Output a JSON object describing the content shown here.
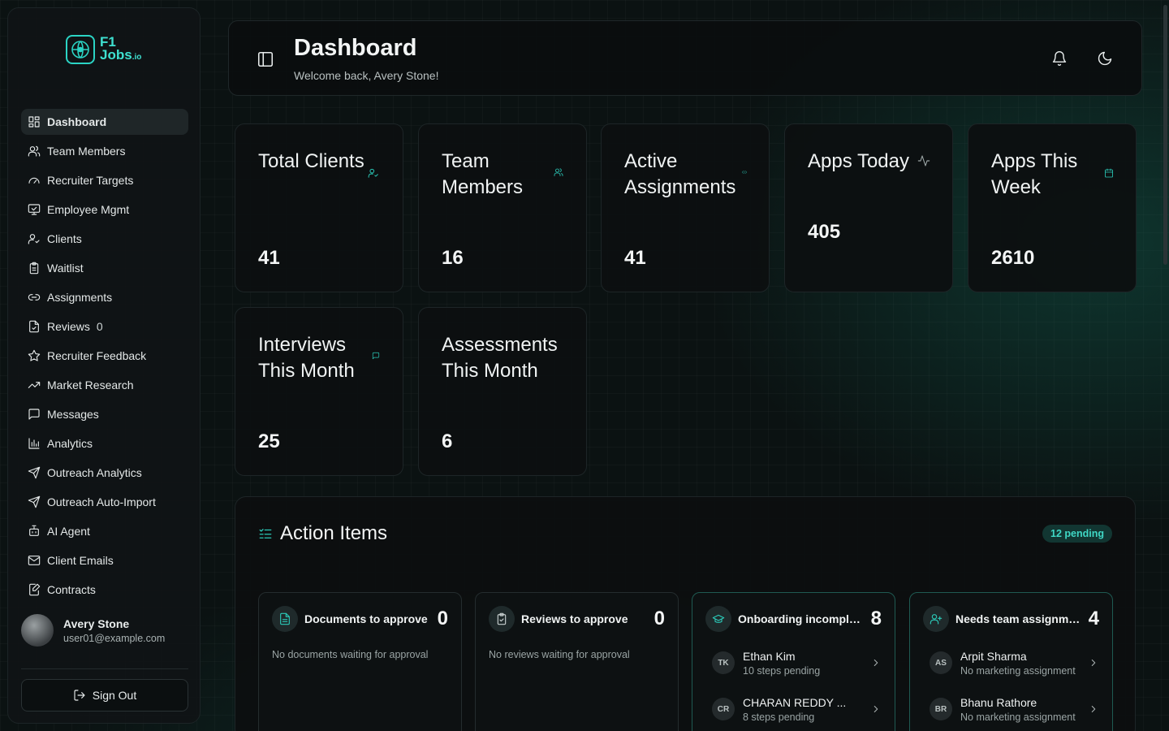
{
  "brand": {
    "name_line1": "F1",
    "name_line2": "Jobs",
    "name_suffix": ".io",
    "accent": "#2bd4c4"
  },
  "sidebar": {
    "items": [
      {
        "label": "Dashboard",
        "icon": "dashboard-icon",
        "active": true
      },
      {
        "label": "Team Members",
        "icon": "users-icon"
      },
      {
        "label": "Recruiter Targets",
        "icon": "gauge-icon"
      },
      {
        "label": "Employee Mgmt",
        "icon": "monitor-icon"
      },
      {
        "label": "Clients",
        "icon": "user-check-icon"
      },
      {
        "label": "Waitlist",
        "icon": "clipboard-icon"
      },
      {
        "label": "Assignments",
        "icon": "link-icon"
      },
      {
        "label": "Reviews",
        "icon": "file-check-icon",
        "count": "0"
      },
      {
        "label": "Recruiter Feedback",
        "icon": "star-icon"
      },
      {
        "label": "Market Research",
        "icon": "trending-up-icon"
      },
      {
        "label": "Messages",
        "icon": "message-icon"
      },
      {
        "label": "Analytics",
        "icon": "bar-chart-icon"
      },
      {
        "label": "Outreach Analytics",
        "icon": "send-icon"
      },
      {
        "label": "Outreach Auto-Import",
        "icon": "send-icon"
      },
      {
        "label": "AI Agent",
        "icon": "bot-icon"
      },
      {
        "label": "Client Emails",
        "icon": "mail-icon"
      },
      {
        "label": "Contracts",
        "icon": "file-edit-icon"
      }
    ],
    "user": {
      "name": "Avery Stone",
      "email": "user01@example.com"
    },
    "sign_out": "Sign Out"
  },
  "header": {
    "title": "Dashboard",
    "subtitle": "Welcome back, Avery Stone!"
  },
  "stats": [
    {
      "title": "Total Clients",
      "value": "41",
      "icon": "user-check-icon"
    },
    {
      "title": "Team Members",
      "value": "16",
      "icon": "users-icon"
    },
    {
      "title": "Active Assignments",
      "value": "41",
      "icon": "link-icon"
    },
    {
      "title": "Apps Today",
      "value": "405",
      "icon": "activity-icon"
    },
    {
      "title": "Apps This Week",
      "value": "2610",
      "icon": "calendar-icon"
    },
    {
      "title": "Interviews This Month",
      "value": "25",
      "icon": "message-icon"
    },
    {
      "title": "Assessments This Month",
      "value": "6",
      "icon": ""
    }
  ],
  "actions": {
    "title": "Action Items",
    "pending": "12 pending",
    "cards": [
      {
        "label": "Documents to approve",
        "count": "0",
        "icon": "file-text-icon",
        "empty": "No documents waiting for approval",
        "rows": []
      },
      {
        "label": "Reviews to approve",
        "count": "0",
        "icon": "clipboard-check-icon",
        "empty": "No reviews waiting for approval",
        "rows": []
      },
      {
        "label": "Onboarding incomplete",
        "count": "8",
        "icon": "graduation-cap-icon",
        "empty": "",
        "rows": [
          {
            "initials": "TK",
            "name": "Ethan Kim",
            "status": "10 steps pending"
          },
          {
            "initials": "CR",
            "name": "CHARAN REDDY ...",
            "status": "8 steps pending"
          }
        ]
      },
      {
        "label": "Needs team assignment",
        "count": "4",
        "icon": "user-plus-icon",
        "empty": "",
        "rows": [
          {
            "initials": "AS",
            "name": "Arpit Sharma",
            "status": "No marketing assignment"
          },
          {
            "initials": "BR",
            "name": "Bhanu Rathore",
            "status": "No marketing assignment"
          }
        ]
      }
    ]
  }
}
